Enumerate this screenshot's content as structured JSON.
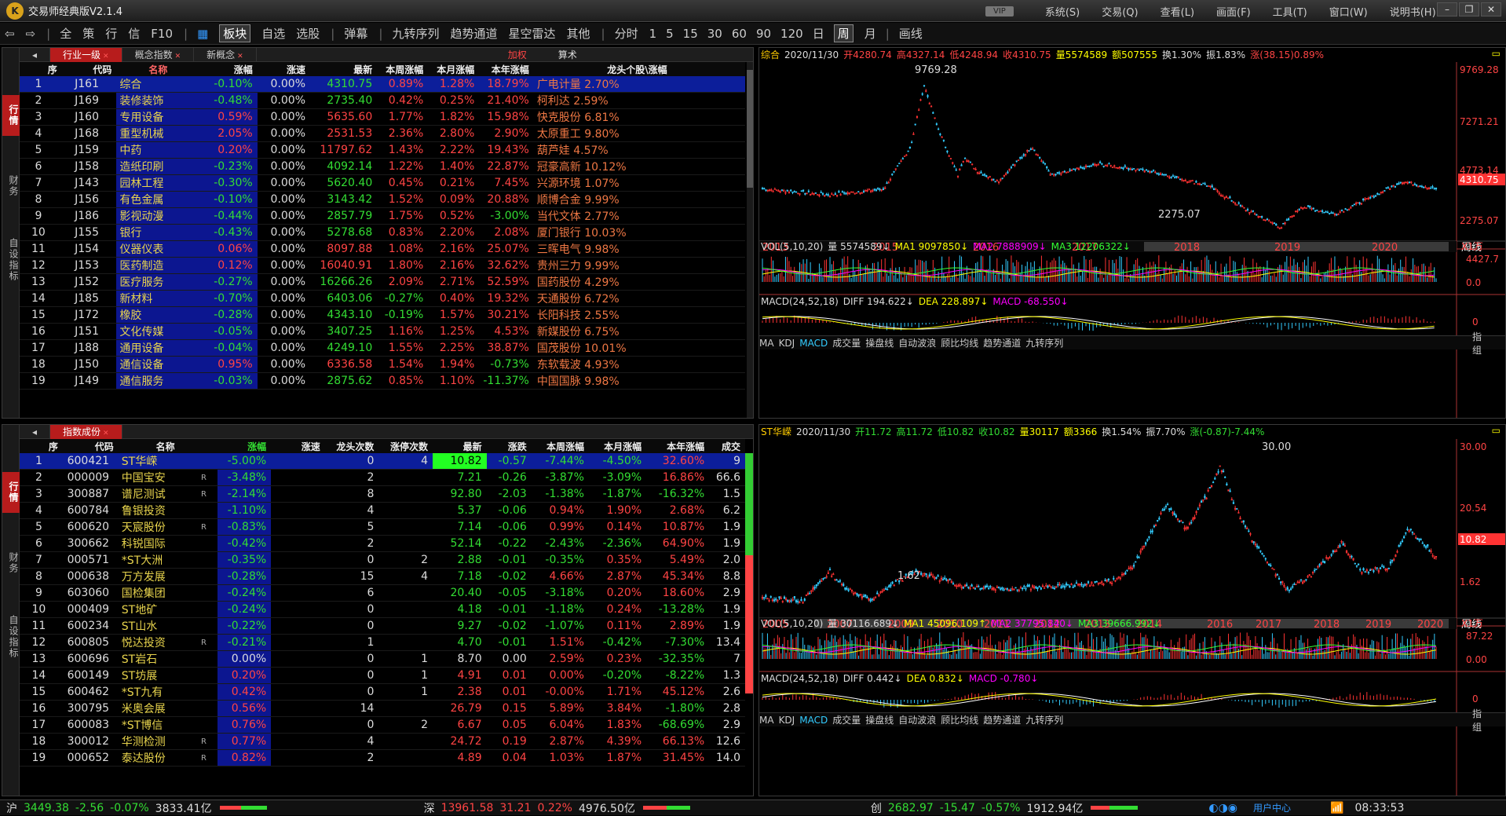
{
  "app": {
    "title": "交易师经典版V2.1.4",
    "logo": "K"
  },
  "menubar": {
    "vip": "VIP",
    "items": [
      "系统(S)",
      "交易(Q)",
      "查看(L)",
      "画面(F)",
      "工具(T)",
      "窗口(W)",
      "说明书(H)"
    ]
  },
  "toolbar": {
    "items": [
      "全",
      "策",
      "行",
      "信",
      "F10",
      "",
      "板块",
      "自选",
      "选股",
      "弹幕",
      "九转序列",
      "趋势通道",
      "星空雷达",
      "其他",
      "分时",
      "1",
      "5",
      "15",
      "30",
      "60",
      "90",
      "120",
      "日",
      "周",
      "月",
      "画线"
    ]
  },
  "top_panel": {
    "side_tabs": [
      "行情",
      "财务",
      "自设指标"
    ],
    "tabs": [
      "行业一级",
      "概念指数",
      "新概念"
    ],
    "sub_buttons": [
      "加权",
      "算术"
    ],
    "headers": [
      "序",
      "代码",
      "名称",
      "涨幅",
      "涨速",
      "最新",
      "本周涨幅",
      "本月涨幅",
      "本年涨幅",
      "龙头个股\\涨幅"
    ],
    "rows": [
      [
        "1",
        "J161",
        "综合",
        "-0.10%",
        "0.00%",
        "4310.75",
        "0.89%",
        "1.28%",
        "18.79%",
        "广电计量 2.70%"
      ],
      [
        "2",
        "J169",
        "装修装饰",
        "-0.48%",
        "0.00%",
        "2735.40",
        "0.42%",
        "0.25%",
        "21.40%",
        "柯利达 2.59%"
      ],
      [
        "3",
        "J160",
        "专用设备",
        "0.59%",
        "0.00%",
        "5635.60",
        "1.77%",
        "1.82%",
        "15.98%",
        "快克股份 6.81%"
      ],
      [
        "4",
        "J168",
        "重型机械",
        "2.05%",
        "0.00%",
        "2531.53",
        "2.36%",
        "2.80%",
        "2.90%",
        "太原重工 9.80%"
      ],
      [
        "5",
        "J159",
        "中药",
        "0.20%",
        "0.00%",
        "11797.62",
        "1.43%",
        "2.22%",
        "19.43%",
        "葫芦娃 4.57%"
      ],
      [
        "6",
        "J158",
        "造纸印刷",
        "-0.23%",
        "0.00%",
        "4092.14",
        "1.22%",
        "1.40%",
        "22.87%",
        "冠豪高新 10.12%"
      ],
      [
        "7",
        "J143",
        "园林工程",
        "-0.30%",
        "0.00%",
        "5620.40",
        "0.45%",
        "0.21%",
        "7.45%",
        "兴源环境 1.07%"
      ],
      [
        "8",
        "J156",
        "有色金属",
        "-0.10%",
        "0.00%",
        "3143.42",
        "1.52%",
        "0.09%",
        "20.88%",
        "顺博合金 9.99%"
      ],
      [
        "9",
        "J186",
        "影视动漫",
        "-0.44%",
        "0.00%",
        "2857.79",
        "1.75%",
        "0.52%",
        "-3.00%",
        "当代文体 2.77%"
      ],
      [
        "10",
        "J155",
        "银行",
        "-0.43%",
        "0.00%",
        "5278.68",
        "0.83%",
        "2.20%",
        "2.08%",
        "厦门银行 10.03%"
      ],
      [
        "11",
        "J154",
        "仪器仪表",
        "0.06%",
        "0.00%",
        "8097.88",
        "1.08%",
        "2.16%",
        "25.07%",
        "三晖电气 9.98%"
      ],
      [
        "12",
        "J153",
        "医药制造",
        "0.12%",
        "0.00%",
        "16040.91",
        "1.80%",
        "2.16%",
        "32.62%",
        "贵州三力 9.99%"
      ],
      [
        "13",
        "J152",
        "医疗服务",
        "-0.27%",
        "0.00%",
        "16266.26",
        "2.09%",
        "2.71%",
        "52.59%",
        "国药股份 4.29%"
      ],
      [
        "14",
        "J185",
        "新材料",
        "-0.70%",
        "0.00%",
        "6403.06",
        "-0.27%",
        "0.40%",
        "19.32%",
        "天通股份 6.72%"
      ],
      [
        "15",
        "J172",
        "橡胶",
        "-0.28%",
        "0.00%",
        "4343.10",
        "-0.19%",
        "1.57%",
        "30.21%",
        "长阳科技 2.55%"
      ],
      [
        "16",
        "J151",
        "文化传媒",
        "-0.05%",
        "0.00%",
        "3407.25",
        "1.16%",
        "1.25%",
        "4.53%",
        "新媒股份 6.75%"
      ],
      [
        "17",
        "J188",
        "通用设备",
        "-0.04%",
        "0.00%",
        "4249.10",
        "1.55%",
        "2.25%",
        "38.87%",
        "国茂股份 10.01%"
      ],
      [
        "18",
        "J150",
        "通信设备",
        "0.95%",
        "0.00%",
        "6336.58",
        "1.54%",
        "1.94%",
        "-0.73%",
        "东软载波 4.93%"
      ],
      [
        "19",
        "J149",
        "通信服务",
        "-0.03%",
        "0.00%",
        "2875.62",
        "0.85%",
        "1.10%",
        "-11.37%",
        "中国国脉 9.98%"
      ]
    ]
  },
  "bottom_panel": {
    "side_tabs": [
      "行情",
      "财务",
      "自设指标"
    ],
    "tabs": [
      "指数成份"
    ],
    "headers": [
      "序",
      "代码",
      "名称",
      "涨幅",
      "涨速",
      "龙头次数",
      "涨停次数",
      "最新",
      "涨跌",
      "本周涨幅",
      "本月涨幅",
      "本年涨幅",
      "成交"
    ],
    "rows": [
      [
        "1",
        "600421",
        "ST华嵘",
        "",
        "-5.00%",
        "",
        "0",
        "4",
        "10.82",
        "-0.57",
        "-7.44%",
        "-4.50%",
        "32.60%",
        "9"
      ],
      [
        "2",
        "000009",
        "中国宝安",
        "R",
        "-3.48%",
        "",
        "2",
        "",
        "7.21",
        "-0.26",
        "-3.87%",
        "-3.09%",
        "16.86%",
        "66.6"
      ],
      [
        "3",
        "300887",
        "谱尼测试",
        "R",
        "-2.14%",
        "",
        "8",
        "",
        "92.80",
        "-2.03",
        "-1.38%",
        "-1.87%",
        "-16.32%",
        "1.5"
      ],
      [
        "4",
        "600784",
        "鲁银投资",
        "",
        "-1.10%",
        "",
        "4",
        "",
        "5.37",
        "-0.06",
        "0.94%",
        "1.90%",
        "2.68%",
        "6.2"
      ],
      [
        "5",
        "600620",
        "天宸股份",
        "R",
        "-0.83%",
        "",
        "5",
        "",
        "7.14",
        "-0.06",
        "0.99%",
        "0.14%",
        "10.87%",
        "1.9"
      ],
      [
        "6",
        "300662",
        "科锐国际",
        "",
        "-0.42%",
        "",
        "2",
        "",
        "52.14",
        "-0.22",
        "-2.43%",
        "-2.36%",
        "64.90%",
        "1.9"
      ],
      [
        "7",
        "000571",
        "*ST大洲",
        "",
        "-0.35%",
        "",
        "0",
        "2",
        "2.88",
        "-0.01",
        "-0.35%",
        "0.35%",
        "5.49%",
        "2.0"
      ],
      [
        "8",
        "000638",
        "万方发展",
        "",
        "-0.28%",
        "",
        "15",
        "4",
        "7.18",
        "-0.02",
        "4.66%",
        "2.87%",
        "45.34%",
        "8.8"
      ],
      [
        "9",
        "603060",
        "国检集团",
        "",
        "-0.24%",
        "",
        "6",
        "",
        "20.40",
        "-0.05",
        "-3.18%",
        "0.20%",
        "18.60%",
        "2.9"
      ],
      [
        "10",
        "000409",
        "ST地矿",
        "",
        "-0.24%",
        "",
        "0",
        "",
        "4.18",
        "-0.01",
        "-1.18%",
        "0.24%",
        "-13.28%",
        "1.9"
      ],
      [
        "11",
        "600234",
        "ST山水",
        "",
        "-0.22%",
        "",
        "0",
        "",
        "9.27",
        "-0.02",
        "-1.07%",
        "0.11%",
        "2.89%",
        "1.9"
      ],
      [
        "12",
        "600805",
        "悦达投资",
        "R",
        "-0.21%",
        "",
        "1",
        "",
        "4.70",
        "-0.01",
        "1.51%",
        "-0.42%",
        "-7.30%",
        "13.4"
      ],
      [
        "13",
        "600696",
        "ST岩石",
        "",
        "0.00%",
        "",
        "0",
        "1",
        "8.70",
        "0.00",
        "2.59%",
        "0.23%",
        "-32.35%",
        "7"
      ],
      [
        "14",
        "600149",
        "ST坊展",
        "",
        "0.20%",
        "",
        "0",
        "1",
        "4.91",
        "0.01",
        "0.00%",
        "-0.20%",
        "-8.22%",
        "1.3"
      ],
      [
        "15",
        "600462",
        "*ST九有",
        "",
        "0.42%",
        "",
        "0",
        "1",
        "2.38",
        "0.01",
        "-0.00%",
        "1.71%",
        "45.12%",
        "2.6"
      ],
      [
        "16",
        "300795",
        "米奥会展",
        "",
        "0.56%",
        "",
        "14",
        "",
        "26.79",
        "0.15",
        "5.89%",
        "3.84%",
        "-1.80%",
        "2.8"
      ],
      [
        "17",
        "600083",
        "*ST博信",
        "",
        "0.76%",
        "",
        "0",
        "2",
        "6.67",
        "0.05",
        "6.04%",
        "1.83%",
        "-68.69%",
        "2.9"
      ],
      [
        "18",
        "300012",
        "华测检测",
        "R",
        "0.77%",
        "",
        "4",
        "",
        "24.72",
        "0.19",
        "2.87%",
        "4.39%",
        "66.13%",
        "12.6"
      ],
      [
        "19",
        "000652",
        "泰达股份",
        "R",
        "0.82%",
        "",
        "2",
        "",
        "4.89",
        "0.04",
        "1.03%",
        "1.87%",
        "31.45%",
        "14.0"
      ]
    ]
  },
  "top_chart": {
    "header": [
      [
        "综合",
        "#fc0"
      ],
      [
        "2020/11/30",
        "#ddd"
      ],
      [
        "开4280.74",
        "#f44"
      ],
      [
        "高4327.14",
        "#f44"
      ],
      [
        "低4248.94",
        "#f44"
      ],
      [
        "收4310.75",
        "#f44"
      ],
      [
        "量5574589",
        "#ff0"
      ],
      [
        "额507555",
        "#ff0"
      ],
      [
        "换1.30%",
        "#ddd"
      ],
      [
        "振1.83%",
        "#ddd"
      ],
      [
        "涨(38.15)0.89%",
        "#f44"
      ]
    ],
    "price_labels": [
      "9769.28",
      "7271.21",
      "4773.14",
      "4310.75",
      "2275.07"
    ],
    "peak_label": "9769.28",
    "low_label": "2275.07",
    "years": [
      "2013",
      "2015",
      "2016",
      "2017",
      "2018",
      "2019",
      "2020"
    ],
    "period": "周线",
    "vol_header": [
      [
        "VOL(5,10,20)",
        "#ddd"
      ],
      [
        "量 5574589↓",
        "#ddd"
      ],
      [
        "MA1 9097850↓",
        "#ff0"
      ],
      [
        "MA2 7888909↓",
        "#f0f"
      ],
      [
        "MA3 12206322↓",
        "#3f3"
      ]
    ],
    "vol_unit": "X1万",
    "vol_labels": [
      "4427.7",
      "0.0"
    ],
    "macd_header": [
      [
        "MACD(24,52,18)",
        "#ddd"
      ],
      [
        "DIFF 194.622↓",
        "#ddd"
      ],
      [
        "DEA 228.897↓",
        "#ff0"
      ],
      [
        "MACD -68.550↓",
        "#f0f"
      ]
    ],
    "macd_labels": [
      "0"
    ],
    "indicators": [
      "MA",
      "KDJ",
      "MACD",
      "成交量",
      "操盘线",
      "自动波浪",
      "顾比均线",
      "趋势通道",
      "九转序列"
    ],
    "right_tabs": [
      "指",
      "组"
    ]
  },
  "bottom_chart": {
    "header": [
      [
        "ST华嵘",
        "#fc0"
      ],
      [
        "2020/11/30",
        "#ddd"
      ],
      [
        "开11.72",
        "#3d3"
      ],
      [
        "高11.72",
        "#3d3"
      ],
      [
        "低10.82",
        "#3d3"
      ],
      [
        "收10.82",
        "#3d3"
      ],
      [
        "量30117",
        "#ff0"
      ],
      [
        "额3366",
        "#ff0"
      ],
      [
        "换1.54%",
        "#ddd"
      ],
      [
        "振7.70%",
        "#ddd"
      ],
      [
        "涨(-0.87)-7.44%",
        "#3d3"
      ]
    ],
    "price_labels": [
      "30.00",
      "20.54",
      "10.82",
      "1.62"
    ],
    "peak_label": "30.00",
    "low_label": "1.62",
    "years": [
      "2005",
      "2007",
      "2009",
      "2010",
      "2011",
      "2012",
      "2013",
      "2014",
      "2016",
      "2017",
      "2018",
      "2019",
      "2020"
    ],
    "period": "周线",
    "vol_header": [
      [
        "VOL(5,10,20)",
        "#ddd"
      ],
      [
        "量 30116.689↓",
        "#ddd"
      ],
      [
        "MA1 45096.109↑",
        "#ff0"
      ],
      [
        "MA2 37795.840↓",
        "#f0f"
      ],
      [
        "MA3 39666.992↓",
        "#3f3"
      ]
    ],
    "vol_unit": "X1万",
    "vol_labels": [
      "87.22",
      "0.00"
    ],
    "macd_header": [
      [
        "MACD(24,52,18)",
        "#ddd"
      ],
      [
        "DIFF 0.442↓",
        "#ddd"
      ],
      [
        "DEA 0.832↓",
        "#ff0"
      ],
      [
        "MACD -0.780↓",
        "#f0f"
      ]
    ],
    "macd_labels": [
      "0"
    ],
    "indicators": [
      "MA",
      "KDJ",
      "MACD",
      "成交量",
      "操盘线",
      "自动波浪",
      "顾比均线",
      "趋势通道",
      "九转序列"
    ],
    "right_tabs": [
      "指",
      "组"
    ]
  },
  "statusbar": {
    "sh": {
      "label": "沪",
      "price": "3449.38",
      "chg": "-2.56",
      "pct": "-0.07%",
      "amt": "3833.41亿"
    },
    "sz": {
      "label": "深",
      "price": "13961.58",
      "chg": "31.21",
      "pct": "0.22%",
      "amt": "4976.50亿"
    },
    "cy": {
      "label": "创",
      "price": "2682.97",
      "chg": "-15.47",
      "pct": "-0.57%",
      "amt": "1912.94亿"
    },
    "user": "用户中心",
    "time": "08:33:53"
  }
}
